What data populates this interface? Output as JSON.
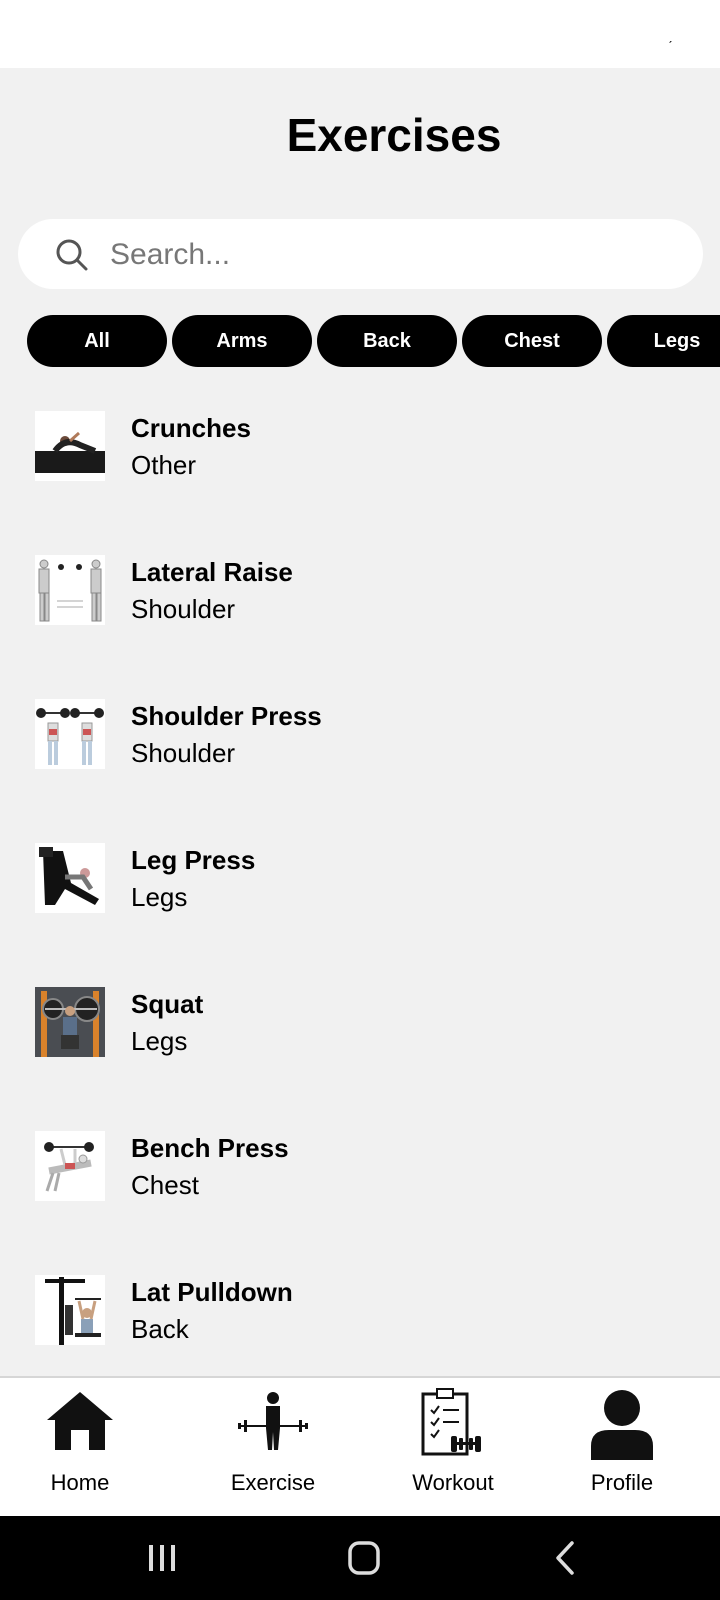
{
  "status_bar": {
    "mark": "ˊ"
  },
  "page": {
    "title": "Exercises"
  },
  "search": {
    "placeholder": "Search..."
  },
  "filters": [
    "All",
    "Arms",
    "Back",
    "Chest",
    "Legs"
  ],
  "exercises": [
    {
      "name": "Crunches",
      "category": "Other"
    },
    {
      "name": "Lateral Raise",
      "category": "Shoulder"
    },
    {
      "name": "Shoulder Press",
      "category": "Shoulder"
    },
    {
      "name": "Leg Press",
      "category": "Legs"
    },
    {
      "name": "Squat",
      "category": "Legs"
    },
    {
      "name": "Bench Press",
      "category": "Chest"
    },
    {
      "name": "Lat Pulldown",
      "category": "Back"
    }
  ],
  "bottom_nav": [
    {
      "label": "Home",
      "icon": "home-icon"
    },
    {
      "label": "Exercise",
      "icon": "barbell-lifter-icon"
    },
    {
      "label": "Workout",
      "icon": "clipboard-dumbbell-icon"
    },
    {
      "label": "Profile",
      "icon": "person-icon"
    }
  ],
  "system_nav": [
    {
      "icon": "recent-apps-icon"
    },
    {
      "icon": "home-circle-icon"
    },
    {
      "icon": "back-chevron-icon"
    }
  ],
  "colors": {
    "background": "#f1f1f1",
    "chip": "#000000",
    "chip_text": "#ffffff",
    "surface": "#ffffff"
  }
}
